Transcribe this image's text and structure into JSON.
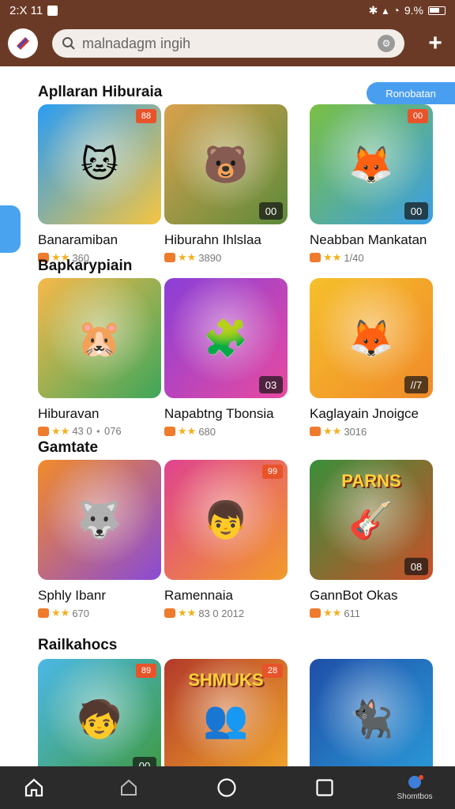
{
  "status": {
    "time": "2:X 11",
    "battery_text": "9.%"
  },
  "search": {
    "placeholder": "malnadagm ingih"
  },
  "promo_label": "Ronobatan",
  "sections": [
    {
      "title": "Apllaran Hiburaia",
      "cards": [
        {
          "title": "Banaramiban",
          "rating": "360",
          "badge_top": "88",
          "badge_bottom": "",
          "icon": "cartoon-cat-icon",
          "bg1": "#2a9df4",
          "bg2": "#f5c542",
          "glyph": "🐱"
        },
        {
          "title": "Hiburahn Ihlslaa",
          "rating": "3890",
          "badge_top": "",
          "badge_bottom": "00",
          "icon": "cartoon-bear-icon",
          "bg1": "#d9a24e",
          "bg2": "#5c8a3a",
          "glyph": "🐻"
        },
        {
          "title": "Neabban Mankatan",
          "rating": "1/40",
          "badge_top": "00",
          "badge_bottom": "00",
          "icon": "cartoon-fox-icon",
          "bg1": "#7ac043",
          "bg2": "#3b9ee5",
          "glyph": "🦊"
        }
      ]
    },
    {
      "title": "Bapkarypiain",
      "cards": [
        {
          "title": "Hiburavan",
          "rating": "43 0 ⋆ 076",
          "badge_top": "",
          "badge_bottom": "",
          "icon": "cartoon-bear-icon",
          "bg1": "#f7b94a",
          "bg2": "#3ea65a",
          "glyph": "🐹"
        },
        {
          "title": "Napabtng Tbonsia",
          "rating": "680",
          "badge_top": "",
          "badge_bottom": "03",
          "icon": "puzzle-blocks-icon",
          "bg1": "#8a3fd8",
          "bg2": "#e84aa0",
          "glyph": "🧩"
        },
        {
          "title": "Kaglayain Jnoigce",
          "rating": "3016",
          "badge_top": "",
          "badge_bottom": "//7",
          "icon": "cartoon-fox-icon",
          "bg1": "#f6c02b",
          "bg2": "#f08a2a",
          "glyph": "🦊"
        }
      ]
    },
    {
      "title": "Gamtate",
      "cards": [
        {
          "title": "Sphly Ibanr",
          "rating": "670",
          "badge_top": "",
          "badge_bottom": "",
          "icon": "cartoon-wolf-icon",
          "bg1": "#f28b2a",
          "bg2": "#8a4ad6",
          "glyph": "🐺"
        },
        {
          "title": "Ramennaia",
          "rating": "83 0 2012",
          "badge_top": "99",
          "badge_bottom": "",
          "icon": "cartoon-kid-icon",
          "bg1": "#e0438f",
          "bg2": "#f29b2a",
          "glyph": "👦"
        },
        {
          "title": "GannBot Okas",
          "rating": "611",
          "badge_top": "",
          "badge_bottom": "08",
          "icon": "game-poster-icon",
          "bg1": "#3a8f3a",
          "bg2": "#c9502a",
          "glyph": "🎸",
          "poster": "PARNS"
        }
      ]
    },
    {
      "title": "Railkahocs",
      "cards": [
        {
          "title": "",
          "rating": "",
          "badge_top": "89",
          "badge_bottom": "00",
          "icon": "cartoon-kid-icon",
          "bg1": "#4cb8e6",
          "bg2": "#3f9a40",
          "glyph": "🧒"
        },
        {
          "title": "",
          "rating": "",
          "badge_top": "28",
          "badge_bottom": "",
          "icon": "group-poster-icon",
          "bg1": "#b23a2a",
          "bg2": "#f2a72a",
          "glyph": "👥",
          "poster": "SHMUKS"
        },
        {
          "title": "",
          "rating": "",
          "badge_top": "",
          "badge_bottom": "",
          "icon": "cartoon-panther-icon",
          "bg1": "#1f4fa8",
          "bg2": "#2a9ad8",
          "glyph": "🐈‍⬛"
        }
      ]
    }
  ],
  "nav": {
    "last_label": "Shomtbos"
  }
}
